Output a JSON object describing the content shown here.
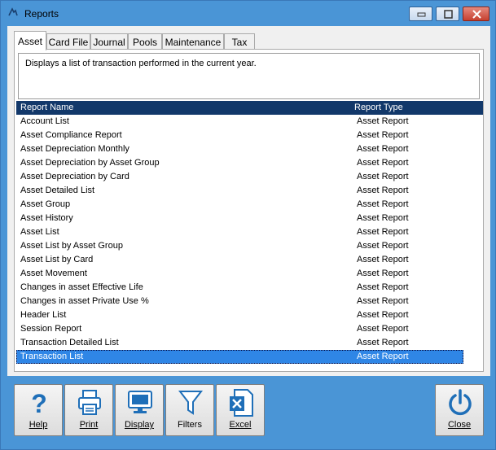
{
  "window": {
    "title": "Reports"
  },
  "tabs": [
    {
      "label": "Asset"
    },
    {
      "label": "Card File"
    },
    {
      "label": "Journal"
    },
    {
      "label": "Pools"
    },
    {
      "label": "Maintenance"
    },
    {
      "label": "Tax"
    }
  ],
  "description": "Displays a list of transaction performed in the current year.",
  "list": {
    "columns": [
      "Report Name",
      "Report Type"
    ],
    "rows": [
      {
        "name": "Account List",
        "type": "Asset Report"
      },
      {
        "name": "Asset Compliance Report",
        "type": "Asset Report"
      },
      {
        "name": "Asset Depreciation Monthly",
        "type": "Asset Report"
      },
      {
        "name": "Asset Depreciation by Asset Group",
        "type": "Asset Report"
      },
      {
        "name": "Asset Depreciation by Card",
        "type": "Asset Report"
      },
      {
        "name": "Asset Detailed List",
        "type": "Asset Report"
      },
      {
        "name": "Asset Group",
        "type": "Asset Report"
      },
      {
        "name": "Asset History",
        "type": "Asset Report"
      },
      {
        "name": "Asset List",
        "type": "Asset Report"
      },
      {
        "name": "Asset List by Asset Group",
        "type": "Asset Report"
      },
      {
        "name": "Asset List by Card",
        "type": "Asset Report"
      },
      {
        "name": "Asset Movement",
        "type": "Asset Report"
      },
      {
        "name": "Changes in asset Effective Life",
        "type": "Asset Report"
      },
      {
        "name": "Changes in asset Private Use %",
        "type": "Asset Report"
      },
      {
        "name": "Header List",
        "type": "Asset Report"
      },
      {
        "name": "Session Report",
        "type": "Asset Report"
      },
      {
        "name": "Transaction Detailed List",
        "type": "Asset Report"
      },
      {
        "name": "Transaction List",
        "type": "Asset Report"
      }
    ],
    "selected_row": "Transaction List"
  },
  "toolbar": {
    "help": "Help",
    "print": "Print",
    "display": "Display",
    "filters": "Filters",
    "excel": "Excel",
    "close": "Close"
  },
  "icons": {
    "help": "question-mark-icon",
    "print": "printer-icon",
    "display": "monitor-icon",
    "filters": "funnel-icon",
    "excel": "excel-icon",
    "close": "power-icon"
  },
  "colors": {
    "frame": "#4a95d6",
    "header_bg": "#12386a",
    "selection": "#2f86e6",
    "icon_blue": "#1f6fb8"
  }
}
